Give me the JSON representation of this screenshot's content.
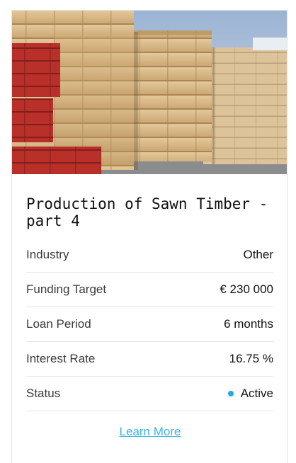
{
  "card": {
    "image_alt": "Stacks of sawn timber in a lumber yard",
    "title": "Production of Sawn Timber - part 4",
    "details": [
      {
        "label": "Industry",
        "value": "Other"
      },
      {
        "label": "Funding Target",
        "value": "€ 230 000"
      },
      {
        "label": "Loan Period",
        "value": "6 months"
      },
      {
        "label": "Interest Rate",
        "value": "16.75 %"
      },
      {
        "label": "Status",
        "value": "Active"
      }
    ],
    "status_color": "#22a9e0",
    "link_color": "#3bb4e4",
    "learn_more_label": "Learn More"
  }
}
